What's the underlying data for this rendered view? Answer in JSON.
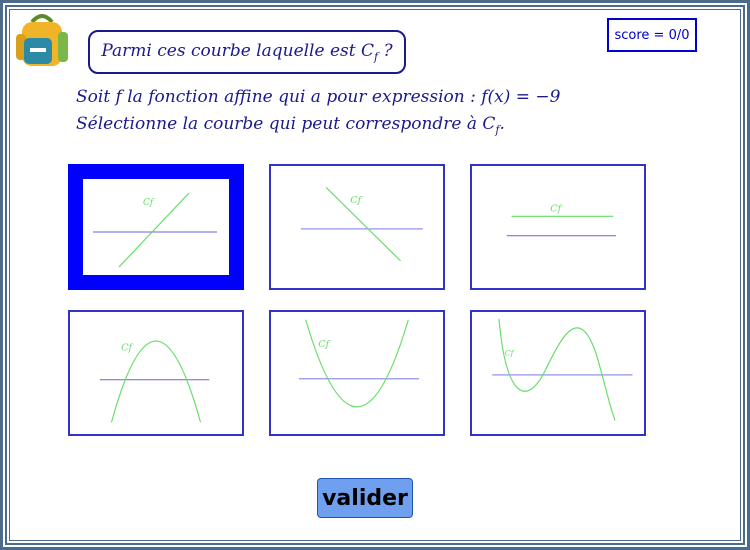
{
  "header": {
    "question_prefix": "Parmi ces courbe laquelle est C",
    "question_sub": "f",
    "question_suffix": " ?",
    "score": "score = 0/0"
  },
  "instructions": {
    "line1": "Soit f la fonction affine qui a pour expression : f(x) = −9",
    "line2_prefix": "Sélectionne la courbe qui peut correspondre à C",
    "line2_sub": "f",
    "line2_suffix": "."
  },
  "choices": [
    {
      "label": "Cf",
      "kind": "increasing-line",
      "selected": true
    },
    {
      "label": "Cf",
      "kind": "decreasing-line",
      "selected": false
    },
    {
      "label": "Cf",
      "kind": "horizontal-line",
      "selected": false
    },
    {
      "label": "Cf",
      "kind": "downward-parabola",
      "selected": false
    },
    {
      "label": "Cf",
      "kind": "upward-parabola",
      "selected": false
    },
    {
      "label": "Cf",
      "kind": "cubic",
      "selected": false
    }
  ],
  "colors": {
    "curve": "#66dd66",
    "axis": "#6666dd",
    "selected_border": "#0000ff"
  },
  "button": {
    "label": "valider"
  },
  "icons": {
    "logo": "backpack-icon"
  }
}
